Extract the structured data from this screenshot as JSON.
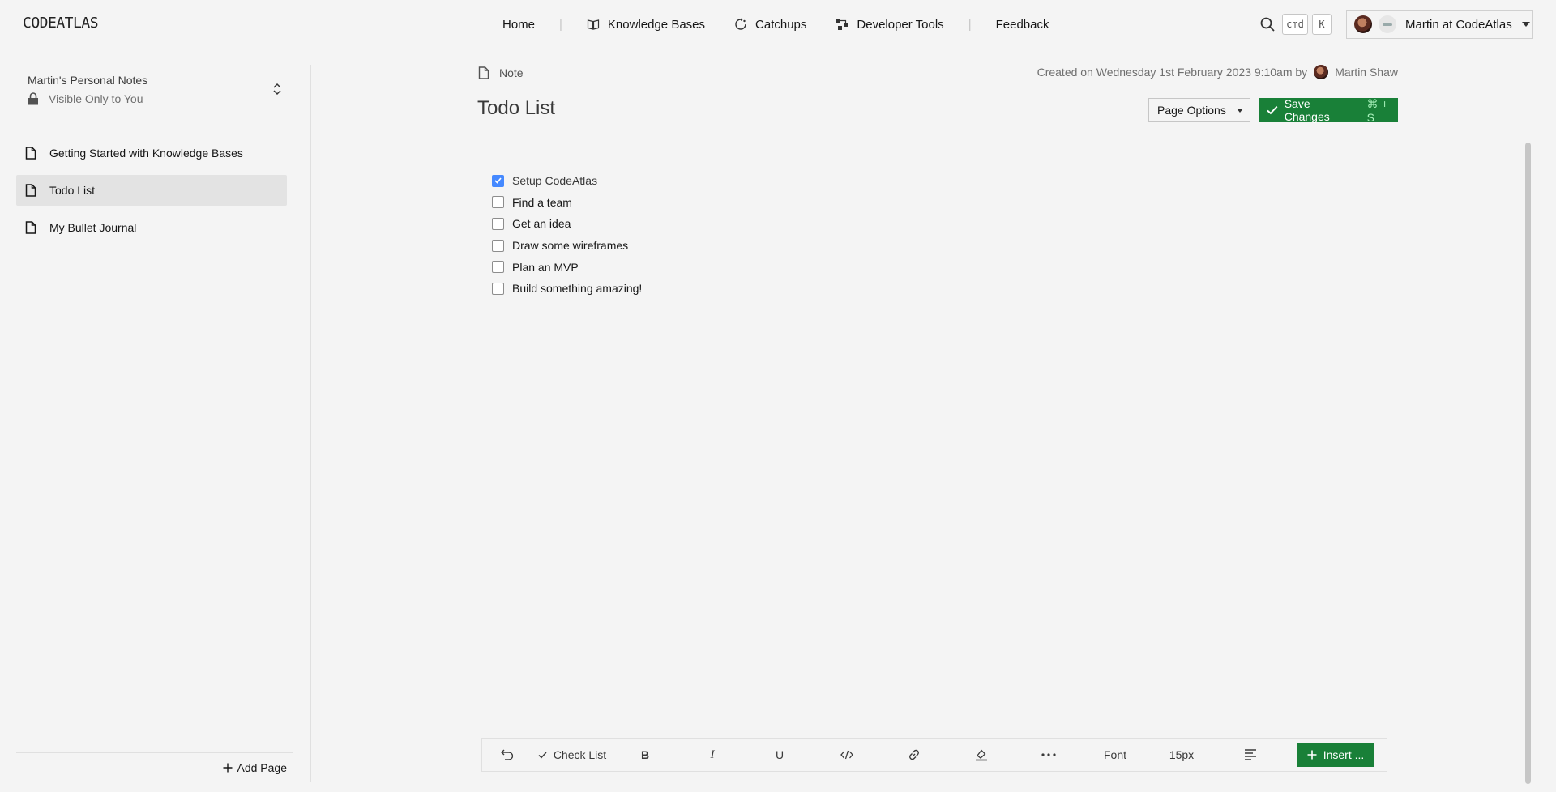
{
  "app": {
    "logo_text": "CODEATLAS"
  },
  "nav": {
    "home": "Home",
    "knowledge_bases": "Knowledge Bases",
    "catchups": "Catchups",
    "developer_tools": "Developer Tools",
    "feedback": "Feedback",
    "separator": "|"
  },
  "shortcut": {
    "cmd": "cmd",
    "k": "K"
  },
  "account": {
    "label": "Martin at CodeAtlas"
  },
  "sidebar": {
    "space_name": "Martin's Personal Notes",
    "visibility": "Visible Only to You",
    "pages": [
      {
        "label": "Getting Started with Knowledge Bases",
        "active": false
      },
      {
        "label": "Todo List",
        "active": true
      },
      {
        "label": "My Bullet Journal",
        "active": false
      }
    ],
    "add_page": "Add Page"
  },
  "doc": {
    "type": "Note",
    "created": "Created on Wednesday 1st February 2023 9:10am by",
    "author": "Martin Shaw",
    "title": "Todo List",
    "page_options": "Page Options",
    "save_label": "Save Changes",
    "save_shortcut": "⌘ + S",
    "checklist": [
      {
        "text": "Setup CodeAtlas",
        "checked": true
      },
      {
        "text": "Find a team",
        "checked": false
      },
      {
        "text": "Get an idea",
        "checked": false
      },
      {
        "text": "Draw some wireframes",
        "checked": false
      },
      {
        "text": "Plan an MVP",
        "checked": false
      },
      {
        "text": "Build something amazing!",
        "checked": false
      }
    ]
  },
  "toolbar": {
    "check_list": "Check List",
    "bold": "B",
    "italic": "I",
    "underline": "U",
    "font": "Font",
    "font_size": "15px",
    "insert": "Insert ..."
  },
  "colors": {
    "accent_green": "#198038",
    "checkbox_blue": "#4589ff"
  }
}
